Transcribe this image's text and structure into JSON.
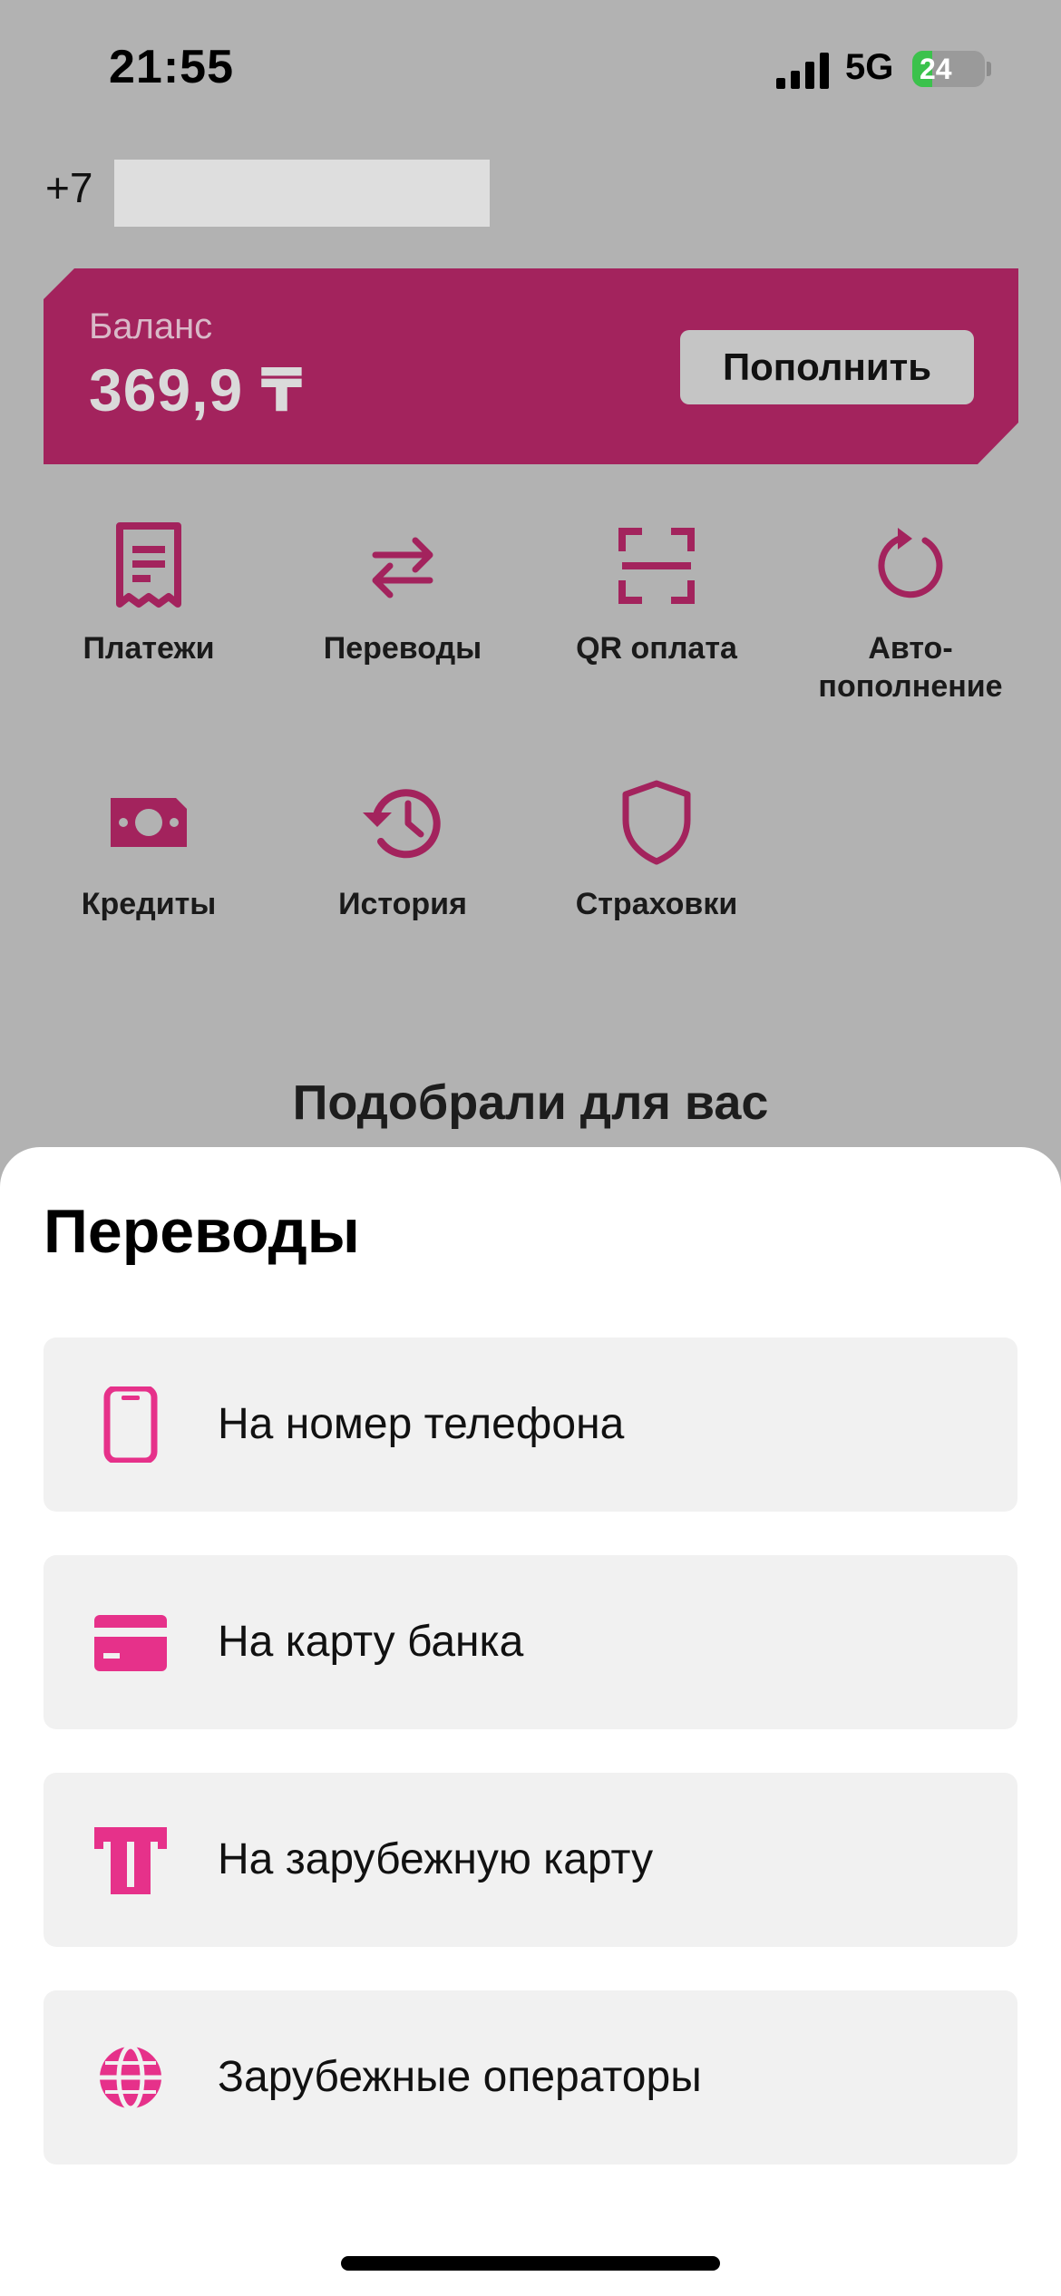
{
  "status_bar": {
    "time": "21:55",
    "network": "5G",
    "battery": "24"
  },
  "account": {
    "phone_prefix": "+7"
  },
  "balance": {
    "label": "Баланс",
    "amount": "369,9 ₸",
    "topup_label": "Пополнить"
  },
  "quick_actions": [
    {
      "label": "Платежи",
      "icon": "receipt-icon"
    },
    {
      "label": "Переводы",
      "icon": "transfer-arrows-icon"
    },
    {
      "label": "QR оплата",
      "icon": "qr-scan-icon"
    },
    {
      "label": "Авто-\nпополнение",
      "icon": "refresh-icon"
    },
    {
      "label": "Кредиты",
      "icon": "banknote-icon"
    },
    {
      "label": "История",
      "icon": "history-icon"
    },
    {
      "label": "Страховки",
      "icon": "shield-icon"
    }
  ],
  "section": {
    "title": "Подобрали для вас"
  },
  "sheet": {
    "title": "Переводы",
    "items": [
      {
        "label": "На номер телефона",
        "icon": "phone-icon"
      },
      {
        "label": "На карту банка",
        "icon": "bank-card-icon"
      },
      {
        "label": "На зарубежную карту",
        "icon": "atm-card-icon"
      },
      {
        "label": "Зарубежные операторы",
        "icon": "globe-icon"
      }
    ]
  },
  "colors": {
    "brand": "#a3235d",
    "accent_pink": "#e6318a",
    "overlay": "#b2b2b2"
  }
}
